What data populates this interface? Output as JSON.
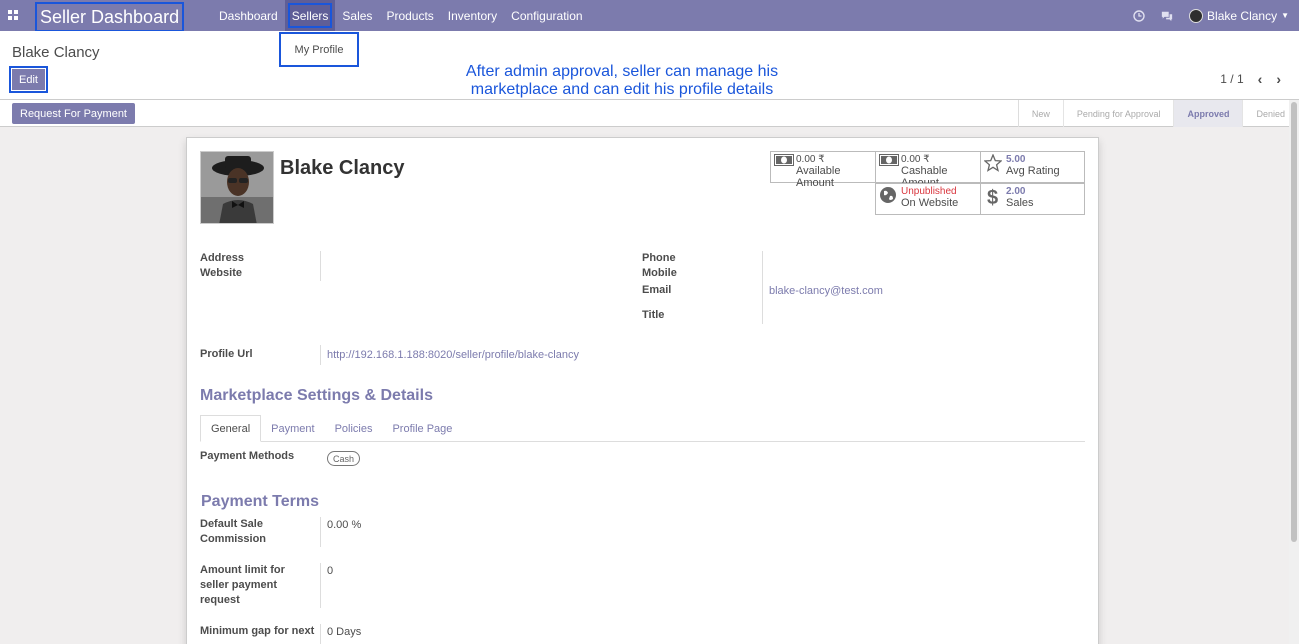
{
  "navbar": {
    "brand": "Seller Dashboard",
    "menu": [
      "Dashboard",
      "Sellers",
      "Sales",
      "Products",
      "Inventory",
      "Configuration"
    ],
    "active_menu": "Sellers",
    "user_name": "Blake Clancy",
    "icons": [
      "apps-icon",
      "clock-icon",
      "chat-icon"
    ]
  },
  "dropdown": {
    "item": "My Profile"
  },
  "control_panel": {
    "breadcrumb": "Blake Clancy",
    "edit_label": "Edit",
    "annotation": "After admin approval, seller can manage his marketplace and can edit his profile details",
    "pager": "1 / 1"
  },
  "statusbar": {
    "request_payment_label": "Request For Payment",
    "stages": [
      "New",
      "Pending for Approval",
      "Approved",
      "Denied"
    ],
    "current_stage": "Approved"
  },
  "profile": {
    "name": "Blake Clancy",
    "stats": {
      "available_amount": {
        "value": "0.00 ₹",
        "label": "Available Amount"
      },
      "cashable_amount": {
        "value": "0.00 ₹",
        "label": "Cashable Amount"
      },
      "avg_rating": {
        "value": "5.00",
        "label": "Avg Rating"
      },
      "website": {
        "value": "Unpublished",
        "label": "On Website"
      },
      "sales": {
        "value": "2.00",
        "label": "Sales"
      }
    },
    "fields": {
      "address_label": "Address",
      "website_label": "Website",
      "phone_label": "Phone",
      "mobile_label": "Mobile",
      "email_label": "Email",
      "email_value": "blake-clancy@test.com",
      "title_label": "Title",
      "profile_url_label": "Profile Url",
      "profile_url_value": "http://192.168.1.188:8020/seller/profile/blake-clancy"
    }
  },
  "marketplace": {
    "title": "Marketplace Settings & Details",
    "tabs": [
      "General",
      "Payment",
      "Policies",
      "Profile Page"
    ],
    "active_tab": "General",
    "payment_methods_label": "Payment Methods",
    "payment_methods_tag": "Cash"
  },
  "payment_terms": {
    "title": "Payment Terms",
    "default_sale_commission_label_1": "Default Sale",
    "default_sale_commission_label_2": "Commission",
    "default_sale_commission_value": "0.00 %",
    "amount_limit_label_1": "Amount limit for",
    "amount_limit_label_2": "seller payment",
    "amount_limit_label_3": "request",
    "amount_limit_value": "0",
    "min_gap_label": "Minimum gap for next",
    "min_gap_value": "0 Days"
  }
}
